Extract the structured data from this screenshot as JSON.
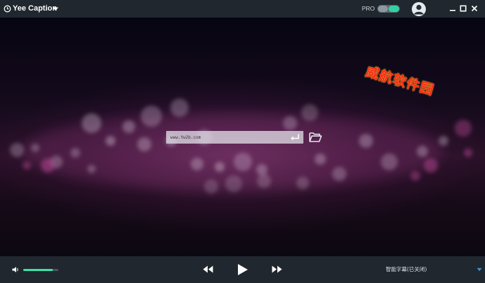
{
  "app": {
    "title": "Yee Caption"
  },
  "header": {
    "pro_label": "PRO",
    "pro_enabled": true
  },
  "watermark": {
    "text": "威航软件园"
  },
  "url_input": {
    "value": "www.Yw2b.com"
  },
  "player": {
    "volume_level": 0.84,
    "subtitle_status": "智能字幕(已关闭)"
  },
  "colors": {
    "accent": "#33d1a3",
    "titlebar": "#20272e",
    "watermark": "#ff2a1c"
  },
  "icons": {
    "logo": "clock-circle-icon",
    "dropdown": "triangle-down-icon",
    "avatar": "user-avatar-icon",
    "minimize": "minimize-icon",
    "maximize": "maximize-icon",
    "close": "close-icon",
    "enter": "enter-return-icon",
    "folder": "open-folder-icon",
    "volume": "speaker-icon",
    "rewind": "rewind-icon",
    "play": "play-icon",
    "forward": "fast-forward-icon",
    "expand": "chevron-down-icon"
  }
}
